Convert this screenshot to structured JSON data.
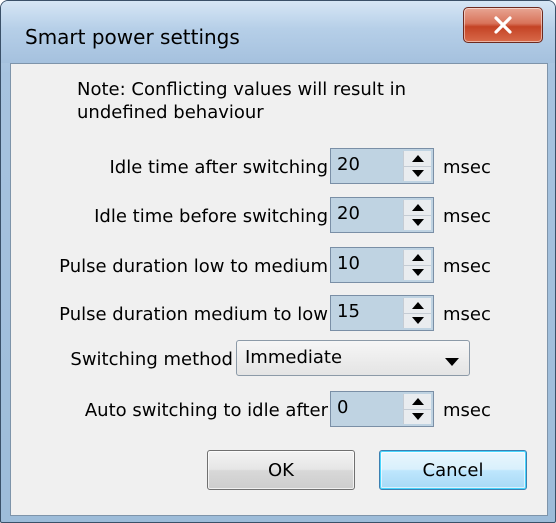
{
  "window": {
    "title": "Smart power settings"
  },
  "note": {
    "line1": "Note: Conflicting values will result in",
    "line2": "undefined behaviour"
  },
  "fields": [
    {
      "label": "Idle time after switching",
      "value": "20",
      "unit": "msec"
    },
    {
      "label": "Idle time before switching",
      "value": "20",
      "unit": "msec"
    },
    {
      "label": "Pulse duration low to medium",
      "value": "10",
      "unit": "msec"
    },
    {
      "label": "Pulse duration medium to low",
      "value": "15",
      "unit": "msec"
    }
  ],
  "switching_method": {
    "label": "Switching method",
    "selected": "Immediate"
  },
  "auto_switch": {
    "label": "Auto switching to idle after",
    "value": "0",
    "unit": "msec"
  },
  "buttons": {
    "ok": "OK",
    "cancel": "Cancel"
  },
  "icons": {
    "close": "close-icon",
    "spin_up": "spin-up-arrow-icon",
    "spin_down": "spin-down-arrow-icon",
    "dropdown": "chevron-down-icon"
  },
  "colors": {
    "close_button": "#c44325",
    "spin_field_bg": "#bfd3e2",
    "dialog_bg": "#f0f0f0",
    "cancel_focus": "#3c7fb1"
  }
}
